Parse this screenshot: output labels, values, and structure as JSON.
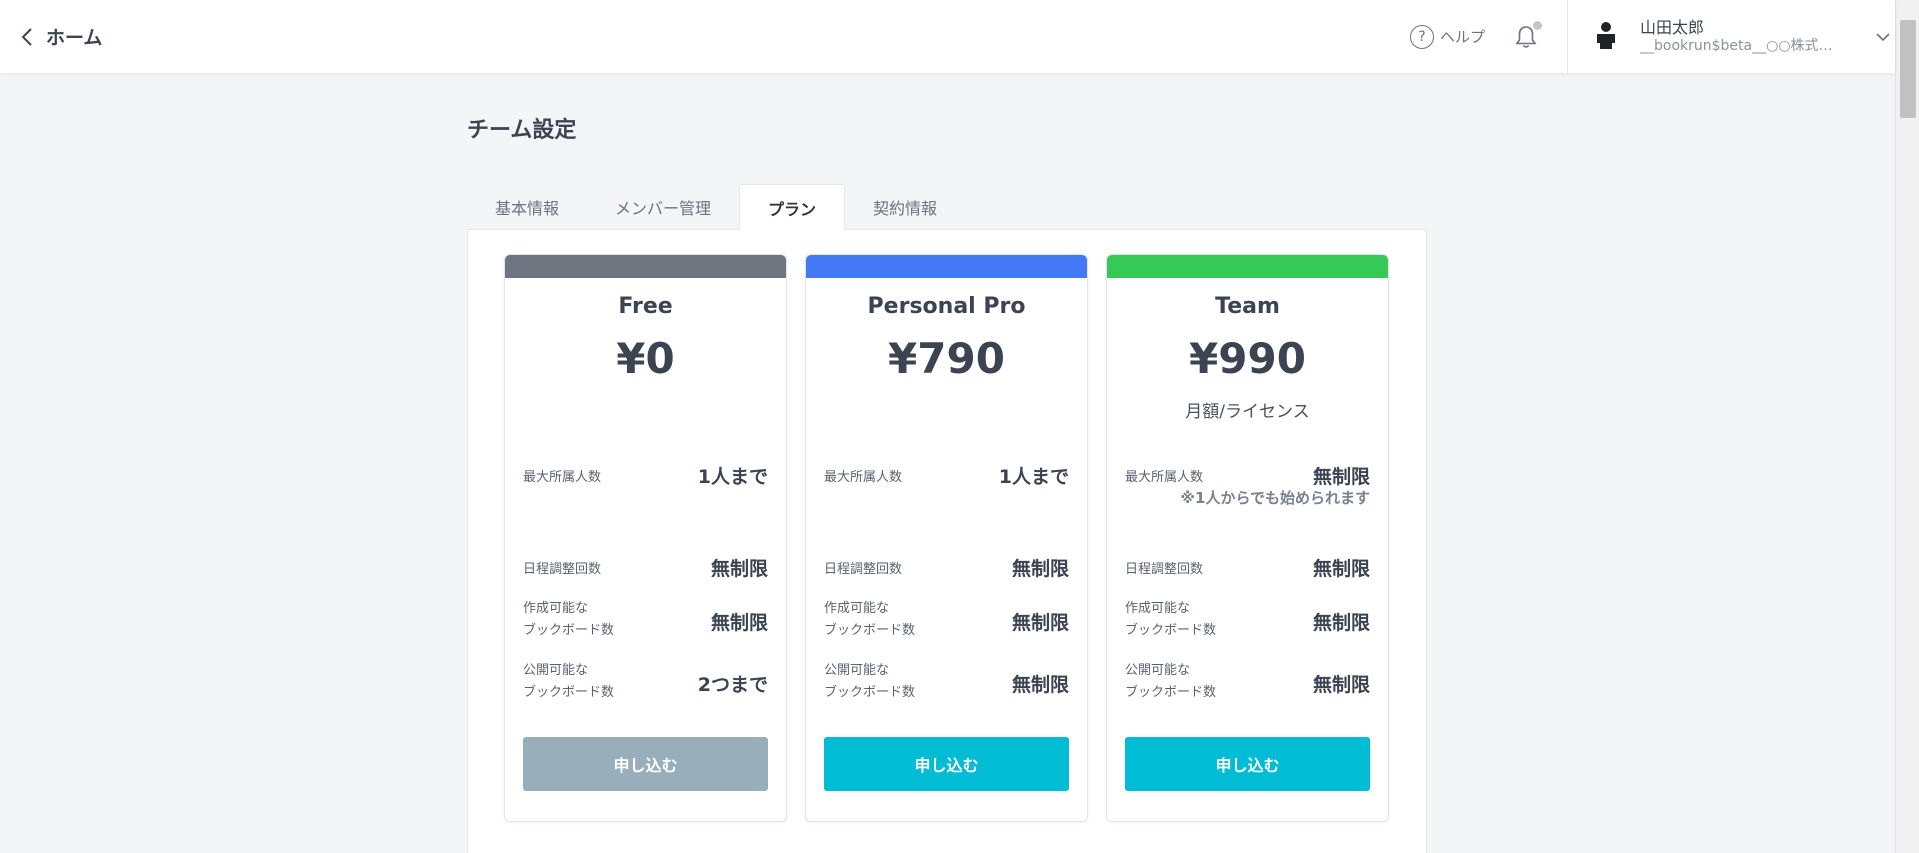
{
  "header": {
    "back_label": "ホーム",
    "help_label": "ヘルプ",
    "user": {
      "name": "山田太郎",
      "sub": "__bookrun$beta__○○株式会社"
    }
  },
  "page": {
    "title": "チーム設定",
    "tabs": [
      {
        "label": "基本情報",
        "active": false
      },
      {
        "label": "メンバー管理",
        "active": false
      },
      {
        "label": "プラン",
        "active": true
      },
      {
        "label": "契約情報",
        "active": false
      }
    ]
  },
  "colors": {
    "free_bar": "#6e7580",
    "pro_bar": "#4479f6",
    "team_bar": "#36c956",
    "button_active": "#00bcd4",
    "button_disabled": "#99aebb"
  },
  "plans": [
    {
      "name": "Free",
      "price": "¥0",
      "price_note": "",
      "features": {
        "members": {
          "label": "最大所属人数",
          "value": "1人まで",
          "note": ""
        },
        "adjust": {
          "label": "日程調整回数",
          "value": "無制限"
        },
        "create": {
          "label_1": "作成可能な",
          "label_2": "ブックボード数",
          "value": "無制限"
        },
        "publish": {
          "label_1": "公開可能な",
          "label_2": "ブックボード数",
          "value": "2つまで"
        }
      },
      "button_label": "申し込む",
      "button_enabled": false
    },
    {
      "name": "Personal Pro",
      "price": "¥790",
      "price_note": "",
      "features": {
        "members": {
          "label": "最大所属人数",
          "value": "1人まで",
          "note": ""
        },
        "adjust": {
          "label": "日程調整回数",
          "value": "無制限"
        },
        "create": {
          "label_1": "作成可能な",
          "label_2": "ブックボード数",
          "value": "無制限"
        },
        "publish": {
          "label_1": "公開可能な",
          "label_2": "ブックボード数",
          "value": "無制限"
        }
      },
      "button_label": "申し込む",
      "button_enabled": true
    },
    {
      "name": "Team",
      "price": "¥990",
      "price_note": "月額/ライセンス",
      "features": {
        "members": {
          "label": "最大所属人数",
          "value": "無制限",
          "note": "※1人からでも始められます"
        },
        "adjust": {
          "label": "日程調整回数",
          "value": "無制限"
        },
        "create": {
          "label_1": "作成可能な",
          "label_2": "ブックボード数",
          "value": "無制限"
        },
        "publish": {
          "label_1": "公開可能な",
          "label_2": "ブックボード数",
          "value": "無制限"
        }
      },
      "button_label": "申し込む",
      "button_enabled": true
    }
  ]
}
